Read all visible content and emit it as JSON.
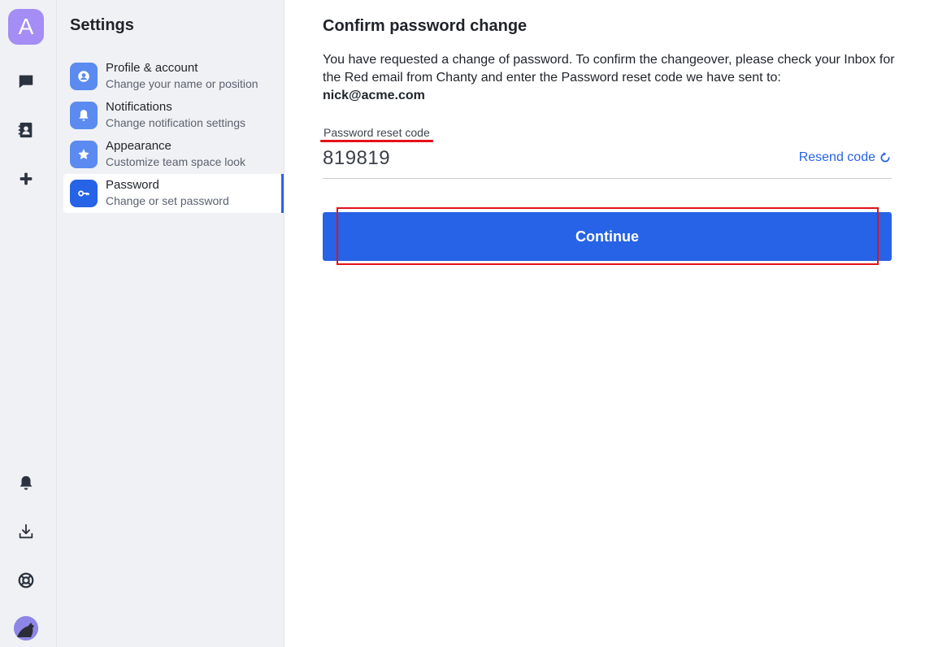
{
  "rail": {
    "team_initial": "A",
    "accent": "#a48df5"
  },
  "settings": {
    "title": "Settings",
    "items": [
      {
        "label": "Profile & account",
        "sub": "Change your name or position",
        "icon": "user-icon"
      },
      {
        "label": "Notifications",
        "sub": "Change notification settings",
        "icon": "bell-icon"
      },
      {
        "label": "Appearance",
        "sub": "Customize team space look",
        "icon": "star-icon"
      },
      {
        "label": "Password",
        "sub": "Change or set password",
        "icon": "key-icon",
        "active": true
      }
    ]
  },
  "main": {
    "title": "Confirm password change",
    "description": "You have requested a change of password. To confirm the changeover, please check your Inbox for the Red email from Chanty and enter the Password reset code we have sent to:",
    "email": "nick@acme.com",
    "field_label": "Password reset code",
    "code_value": "819819",
    "resend_label": "Resend code",
    "continue_label": "Continue",
    "primary_color": "#2663e6"
  }
}
